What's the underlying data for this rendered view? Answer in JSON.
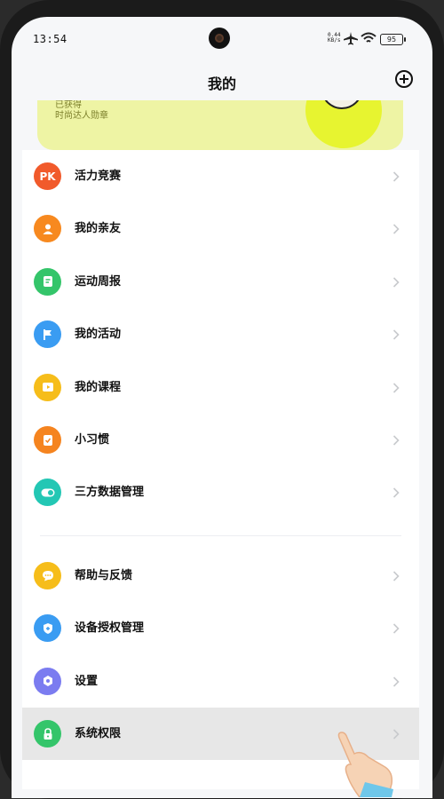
{
  "status_bar": {
    "time": "13:54",
    "net_speed_value": "0.44",
    "net_speed_unit": "KB/s",
    "battery": "95"
  },
  "header": {
    "title": "我的"
  },
  "banner": {
    "line1": "已获得",
    "line2": "时尚达人勋章"
  },
  "menu_group_1": [
    {
      "label": "活力竞赛",
      "icon_text": "PK",
      "icon": "pk-icon",
      "color": "#f15a2b"
    },
    {
      "label": "我的亲友",
      "icon_text": "",
      "icon": "person-icon",
      "color": "#f7891f"
    },
    {
      "label": "运动周报",
      "icon_text": "",
      "icon": "report-icon",
      "color": "#34c56a"
    },
    {
      "label": "我的活动",
      "icon_text": "",
      "icon": "flag-icon",
      "color": "#3a9cf2"
    },
    {
      "label": "我的课程",
      "icon_text": "",
      "icon": "play-icon",
      "color": "#f6bd1a"
    },
    {
      "label": "小习惯",
      "icon_text": "",
      "icon": "checklist-icon",
      "color": "#f5841f"
    },
    {
      "label": "三方数据管理",
      "icon_text": "",
      "icon": "toggle-icon",
      "color": "#23c7b4"
    }
  ],
  "menu_group_2": [
    {
      "label": "帮助与反馈",
      "icon": "chat-icon",
      "color": "#f6bd1a"
    },
    {
      "label": "设备授权管理",
      "icon": "shield-icon",
      "color": "#3a9cf2"
    },
    {
      "label": "设置",
      "icon": "settings-icon",
      "color": "#7b7cf0"
    },
    {
      "label": "系统权限",
      "icon": "lock-icon",
      "color": "#34c56a"
    }
  ]
}
